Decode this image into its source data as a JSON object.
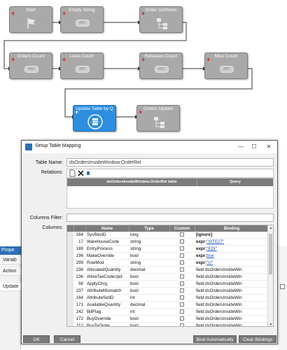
{
  "workflow": {
    "nodes": [
      {
        "label": "Start",
        "icon": "flag-icon"
      },
      {
        "label": "Empty String",
        "icon": "abc-icon",
        "abc": "ABC"
      },
      {
        "label": "Order GetRows",
        "icon": "hierarchy-icon"
      },
      {
        "label": "Orders Count",
        "icon": "abc-icon",
        "abc": "ABC"
      },
      {
        "label": "Lines Count",
        "icon": "abc-icon",
        "abc": "ABC"
      },
      {
        "label": "Releases Count",
        "icon": "abc-icon",
        "abc": "ABC"
      },
      {
        "label": "Misc Count",
        "icon": "abc-icon",
        "abc": "ABC"
      },
      {
        "label": "Update Table by Q",
        "icon": "update-table-icon"
      },
      {
        "label": "Orders Update",
        "icon": "hierarchy-icon"
      }
    ],
    "active_node": "Update Table by Q",
    "colors": {
      "node": "#a9a9a9",
      "active": "#2d8ee0",
      "plus": "#d31a1a"
    }
  },
  "properties_panel": {
    "title": "Prope",
    "rows": [
      "Variab",
      "Action",
      "Update"
    ]
  },
  "dialog": {
    "title": "Setup Table Mapping",
    "table_name_label": "Table Name:",
    "table_name_value": "dsOrdersInsideWindow.OrderRel",
    "relations_label": "Relations:",
    "relations_columns": [
      "dsOrdersInsideWindow.OrderRel table",
      "Query"
    ],
    "columns_filter_label": "Columns Filter:",
    "columns_filter_value": "",
    "columns_label": "Columns:",
    "columns_headers": [
      "Name",
      "Type",
      "Custom",
      "Binding"
    ],
    "rows": [
      {
        "id": "164",
        "name": "SysRevID",
        "type": "long",
        "binding": "[ignore]",
        "kind": "bold"
      },
      {
        "id": "17",
        "name": "WarehouseCode",
        "type": "string",
        "binding_prefix": "expr:",
        "binding_value": "\"SITE27\"",
        "kind": "expr"
      },
      {
        "id": "189",
        "name": "EntryProcess",
        "type": "string",
        "binding_prefix": "expr:",
        "binding_value": "\"EDI\"",
        "kind": "expr"
      },
      {
        "id": "196",
        "name": "MakeOverride",
        "type": "bool",
        "binding_prefix": "expr:",
        "binding_value": "true",
        "kind": "expr"
      },
      {
        "id": "299",
        "name": "RowMod",
        "type": "string",
        "binding_prefix": "expr:",
        "binding_value": "\"U\"",
        "kind": "expr"
      },
      {
        "id": "238",
        "name": "AllocatedQuantity",
        "type": "decimal",
        "binding": "field:dsOrdersInsideWin",
        "kind": "field"
      },
      {
        "id": "236",
        "name": "AllowTaxCodeUpd",
        "type": "bool",
        "binding": "field:dsOrdersInsideWin",
        "kind": "field"
      },
      {
        "id": "56",
        "name": "ApplyChrg",
        "type": "bool",
        "binding": "field:dsOrdersInsideWin",
        "kind": "field"
      },
      {
        "id": "237",
        "name": "AttributeMismatch",
        "type": "bool",
        "binding": "field:dsOrdersInsideWin",
        "kind": "field"
      },
      {
        "id": "164",
        "name": "AttributeSetID",
        "type": "int",
        "binding": "field:dsOrdersInsideWin",
        "kind": "field"
      },
      {
        "id": "171",
        "name": "AvailableQuantity",
        "type": "decimal",
        "binding": "field:dsOrdersInsideWin",
        "kind": "field"
      },
      {
        "id": "242",
        "name": "BillFlag",
        "type": "int",
        "binding": "field:dsOrdersInsideWin",
        "kind": "field"
      },
      {
        "id": "172",
        "name": "BuyOverride",
        "type": "bool",
        "binding": "field:dsOrdersInsideWin",
        "kind": "field"
      },
      {
        "id": "112",
        "name": "BuyToOrder",
        "type": "bool",
        "binding": "field:dsOrdersInsideWin",
        "kind": "field"
      },
      {
        "id": "92",
        "name": "ChangeDate",
        "type": "DateTime?",
        "binding": "field:dsOrdersInsideWin",
        "kind": "field"
      }
    ],
    "buttons": {
      "ok": "OK",
      "cancel": "Cancel",
      "bind_auto": "Bind Automatically",
      "clear": "Clear Bindings"
    }
  }
}
